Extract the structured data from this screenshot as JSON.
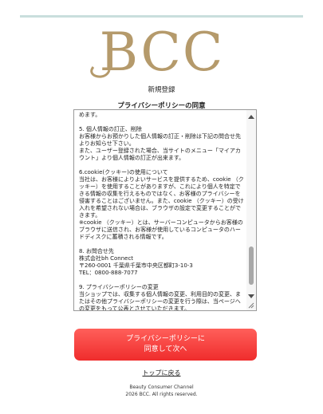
{
  "brand": {
    "logo_text": "BCC",
    "logo_color": "#b59a6b",
    "rule_color": "#c9dedd"
  },
  "header": {
    "page_title": "新規登録",
    "section_title": "プライバシーポリシーの同意"
  },
  "policy": {
    "paragraphs": [
      "めます。",
      "5. 個人情報の訂正、削除\nお客様からお預かりした個人情報の訂正・削除は下記の問合せ先よりお知らせ下さい。\nまた、ユーザー登録された場合、当サイトのメニュー「マイアカウント」より個人情報の訂正が出来ます。",
      "6.cookie(クッキー)の使用について\n当社は、お客様によりよいサービスを提供するため、cookie （クッキー）を使用することがありますが、これにより個人を特定できる情報の収集を行えるものではなく、お客様のプライバシーを侵害することはございません。また、cookie （クッキー）の受け入れを希望されない場合は、ブラウザの設定で変更することができます。\n※cookie （クッキー）とは、サーバーコンピュータからお客様のブラウザに送信され、お客様が使用しているコンピュータのハードディスクに蓄積される情報です。",
      "8. お問合せ先\n株式会社bh Connect\n〒260-0001 千葉県千葉市中央区都町3-10-3\nTEL：0800-888-7077",
      "9. プライバシーポリシーの変更\n当ショップでは、収集する個人情報の変更、利用目的の変更、またはその他プライバシーポリシーの変更を行う際は、当ページへの変更をもって公表とさせていただきます。"
    ]
  },
  "actions": {
    "agree_line1": "プライバシーポリシーに",
    "agree_line2": "同意して次へ",
    "agree_color": "#f23b37",
    "back_top": "トップに戻る"
  },
  "footer": {
    "brand_name": "Beauty Consumer Channel",
    "copyright": "2026 BCC. All rights reserved."
  },
  "icons": {
    "scroll_up": "triangle-up-icon",
    "scroll_down": "triangle-down-icon",
    "resize": "resize-grip-icon"
  }
}
